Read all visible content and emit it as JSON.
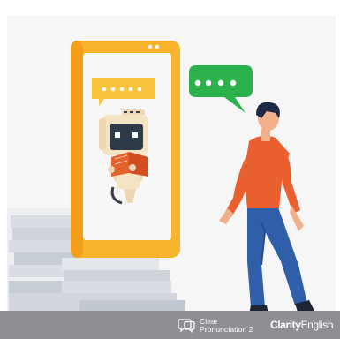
{
  "footer": {
    "product_line1": "Clear",
    "product_line2": "Pronunciation 2",
    "company_bold": "Clarity",
    "company_regular": "English"
  },
  "colors": {
    "phone_frame": "#f9b32c",
    "phone_screen": "#f7f7f7",
    "speech_bubble_left": "#f9c43c",
    "speech_bubble_right": "#2bb24c",
    "shirt": "#ea5f2e",
    "jeans": "#2f5fa8",
    "hair": "#1d2a45",
    "footer_bg": "#8d8f94"
  },
  "icons": {
    "left_bubble": "speech-bubble-icon",
    "right_bubble": "speech-bubble-icon",
    "footer_logo": "speech-logo-icon"
  }
}
